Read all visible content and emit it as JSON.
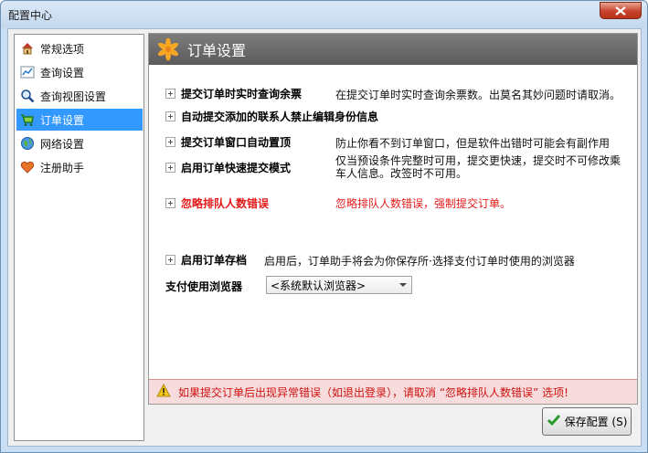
{
  "window": {
    "title": "配置中心",
    "close_icon": "close-icon"
  },
  "sidebar": {
    "items": [
      {
        "label": "常规选项",
        "icon": "home-icon",
        "selected": false
      },
      {
        "label": "查询设置",
        "icon": "chart-icon",
        "selected": false
      },
      {
        "label": "查询视图设置",
        "icon": "magnifier-icon",
        "selected": false
      },
      {
        "label": "订单设置",
        "icon": "cart-icon",
        "selected": true
      },
      {
        "label": "网络设置",
        "icon": "globe-icon",
        "selected": false
      },
      {
        "label": "注册助手",
        "icon": "heart-icon",
        "selected": false
      }
    ]
  },
  "main": {
    "title": "订单设置",
    "options": [
      {
        "label": "提交订单时实时查询余票",
        "desc": "在提交订单时实时查询余票数。出莫名其妙问题时请取消。"
      },
      {
        "label": "自动提交添加的联系人禁止编辑身份信息",
        "desc": ""
      },
      {
        "label": "提交订单窗口自动置顶",
        "desc": "防止你看不到订单窗口，但是软件出错时可能会有副作用"
      },
      {
        "label": "启用订单快速提交模式",
        "desc": "仅当预设条件完整时可用，提交更快速，提交时不可修改乘车人信息。改签时不可用。"
      },
      {
        "label": "忽略排队人数错误",
        "desc": "忽略排队人数错误，强制提交订单。"
      },
      {
        "label": "启用订单存档",
        "desc": "启用后，订单助手将会为你保存所·选择支付订单时使用的浏览器"
      }
    ],
    "browser_label": "支付使用浏览器",
    "browser_value": "<系统默认浏览器>"
  },
  "warning": {
    "text": "如果提交订单后出现异常错误（如退出登录），请取消 “忽略排队人数错误” 选项!"
  },
  "buttons": {
    "save": "保存配置 (S)"
  },
  "colors": {
    "selection": "#3399ff",
    "warning_text": "#d01010",
    "header": "#6b6b6b"
  }
}
